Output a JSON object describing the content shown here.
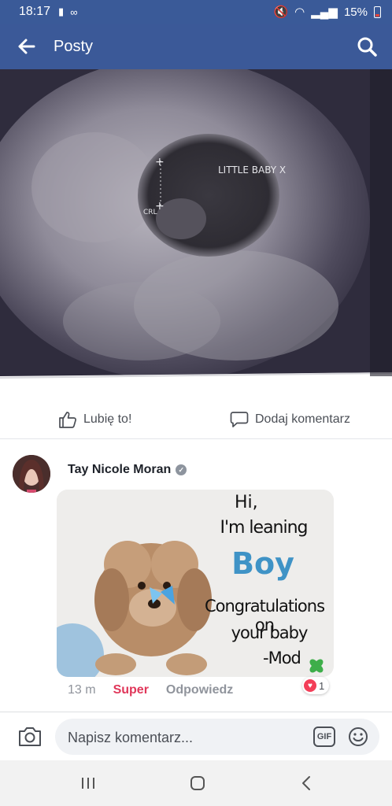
{
  "status_bar": {
    "time": "18:17",
    "battery": "15%"
  },
  "app_bar": {
    "title": "Posty"
  },
  "photo": {
    "annotation": "LITTLE BABY X",
    "crl_label": "CRL"
  },
  "actions": {
    "like_label": "Lubię to!",
    "comment_label": "Dodaj komentarz"
  },
  "comment": {
    "author": "Tay Nicole Moran",
    "meme": {
      "line1": "Hi,",
      "line2": "I'm leaning",
      "line3": "Boy",
      "line4": "Congratulations on",
      "line5": "your baby",
      "line6": "-Mod"
    },
    "time": "13 m",
    "reaction_label": "Super",
    "reply_label": "Odpowiedz",
    "reaction_count": "1"
  },
  "composer": {
    "placeholder": "Napisz komentarz...",
    "gif_label": "GIF"
  },
  "colors": {
    "brand": "#3b5998",
    "super": "#e0375a",
    "heart": "#f33e58",
    "boy": "#3f93c6"
  }
}
